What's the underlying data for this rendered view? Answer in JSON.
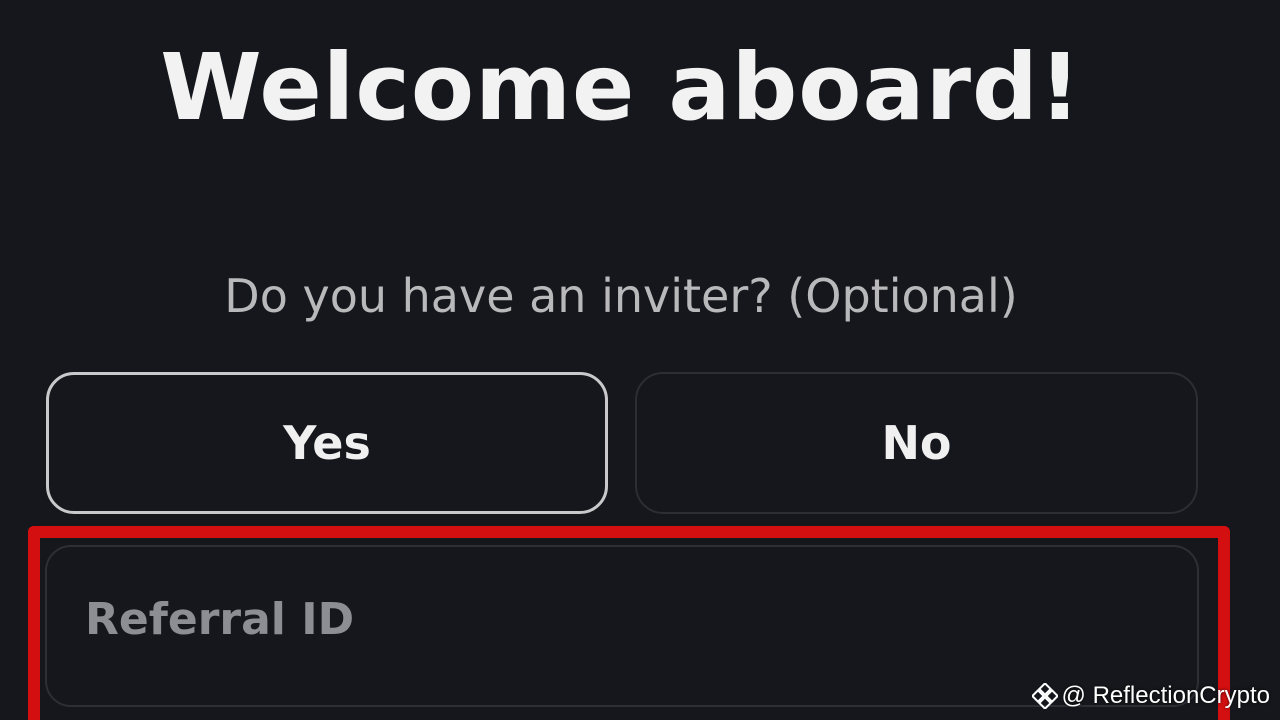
{
  "header": {
    "title": "Welcome aboard!"
  },
  "inviter": {
    "question": "Do you have an inviter? (Optional)",
    "yes_label": "Yes",
    "no_label": "No",
    "selected": "Yes"
  },
  "referral": {
    "placeholder": "Referral ID",
    "value": ""
  },
  "colors": {
    "background": "#16171c",
    "highlight": "#d40f10",
    "text": "#f2f2f2",
    "muted_text": "#b9b9bc"
  },
  "watermark": {
    "icon": "binance-logo-icon",
    "text": "@ ReflectionCrypto"
  }
}
